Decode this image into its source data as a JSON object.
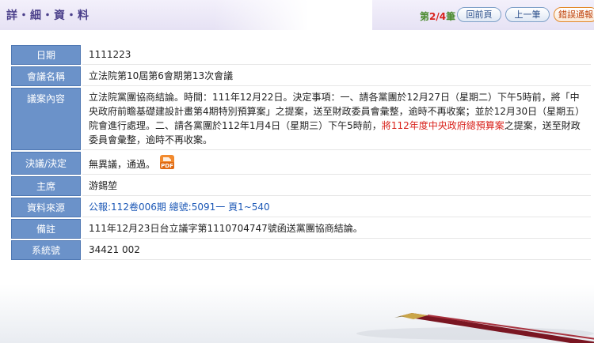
{
  "header": {
    "title": "詳・細・資・料",
    "counter_prefix": "第",
    "counter_num": "2/4",
    "counter_suffix": "筆",
    "back_label": "回前頁",
    "prev_label": "上一筆",
    "report_label": "錯誤通報"
  },
  "rows": {
    "date": {
      "label": "日期",
      "value": "1111223"
    },
    "meeting": {
      "label": "會議名稱",
      "value": "立法院第10屆第6會期第13次會議"
    },
    "content": {
      "label": "議案內容",
      "text1": "立法院黨團協商結論。時間：111年12月22日。決定事項：一、請各黨團於12月27日（星期二）下午5時前，將「中央政府前瞻基礎建設計畫第4期特別預算案」之提案，送至財政委員會彙整，逾時不再收案；並於12月30日（星期五）院會進行處理。二、請各黨團於112年1月4日（星期三）下午5時前，",
      "highlight": "將112年度中央政府總預算案",
      "text2": "之提案，送至財政委員會彙整，逾時不再收案。"
    },
    "decision": {
      "label": "決議/決定",
      "value": "無異議，通過。",
      "pdf_icon": "pdf-icon"
    },
    "chair": {
      "label": "主席",
      "value": "游錫堃"
    },
    "source": {
      "label": "資料來源",
      "value": "公報:112卷006期 總號:5091一 頁1~540"
    },
    "note": {
      "label": "備註",
      "value": "111年12月23日台立議字第1110704747號函送黨團協商結論。"
    },
    "sysno": {
      "label": "系統號",
      "value": "34421 002"
    }
  }
}
